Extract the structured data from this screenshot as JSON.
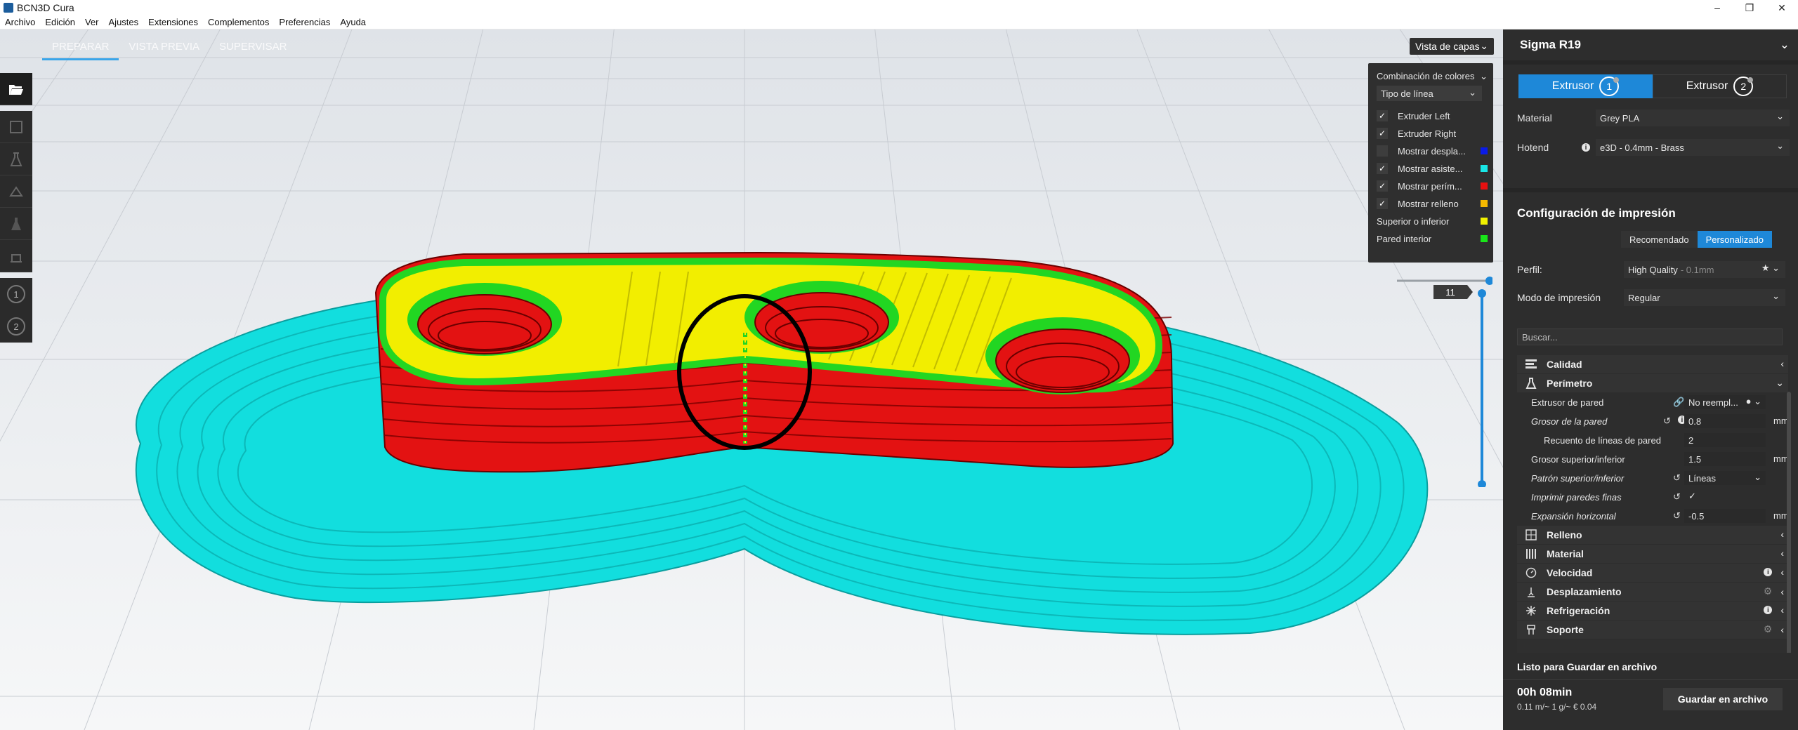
{
  "window": {
    "title": "BCN3D Cura",
    "minimize": "–",
    "maximize": "❐",
    "close": "✕"
  },
  "menu": [
    "Archivo",
    "Edición",
    "Ver",
    "Ajustes",
    "Extensiones",
    "Complementos",
    "Preferencias",
    "Ayuda"
  ],
  "stage_tabs": [
    "PREPARAR",
    "VISTA PREVIA",
    "SUPERVISAR"
  ],
  "view_select": {
    "label": "Vista de capas"
  },
  "color_panel": {
    "title": "Combinación de colores",
    "select": "Tipo de línea",
    "items": [
      {
        "label": "Extruder Left",
        "checked": true,
        "swatch": ""
      },
      {
        "label": "Extruder Right",
        "checked": true,
        "swatch": ""
      },
      {
        "label": "Mostrar despla...",
        "checked": false,
        "swatch": "#0a1be8"
      },
      {
        "label": "Mostrar asiste...",
        "checked": true,
        "swatch": "#19e6e6"
      },
      {
        "label": "Mostrar perím...",
        "checked": true,
        "swatch": "#e81010"
      },
      {
        "label": "Mostrar relleno",
        "checked": true,
        "swatch": "#f5b800"
      },
      {
        "label": "Superior o inferior",
        "checked": null,
        "swatch": "#f2f200"
      },
      {
        "label": "Pared interior",
        "checked": null,
        "swatch": "#19e619"
      }
    ]
  },
  "layer_slider": {
    "current_layer": "11"
  },
  "toolbar": {
    "open_icon": "folder-open-icon",
    "tools": [
      "move-icon",
      "scale-icon",
      "rotate-icon",
      "mirror-icon",
      "support-blocker-icon"
    ],
    "extruders": [
      "1",
      "2"
    ]
  },
  "side_panel": {
    "printer": "Sigma R19",
    "extruder_tabs": [
      {
        "label": "Extrusor",
        "num": "1",
        "active": true
      },
      {
        "label": "Extrusor",
        "num": "2",
        "active": false
      }
    ],
    "material_label": "Material",
    "material_value": "Grey PLA",
    "hotend_label": "Hotend",
    "hotend_value": "e3D - 0.4mm - Brass",
    "print_config_title": "Configuración de impresión",
    "mode_recommended": "Recomendado",
    "mode_custom": "Personalizado",
    "profile_label": "Perfil:",
    "profile_value": "High Quality",
    "profile_layer": "- 0.1mm",
    "print_mode_label": "Modo de impresión",
    "print_mode_value": "Regular",
    "search_placeholder": "Buscar...",
    "categories": {
      "calidad": "Calidad",
      "perimetro": "Perímetro",
      "relleno": "Relleno",
      "material": "Material",
      "velocidad": "Velocidad",
      "desplazamiento": "Desplazamiento",
      "refrigeracion": "Refrigeración",
      "soporte": "Soporte"
    },
    "settings": {
      "wall_extruder": {
        "label": "Extrusor de pared",
        "value": "No reempl..."
      },
      "wall_thickness": {
        "label": "Grosor de la pared",
        "value": "0.8",
        "unit": "mm"
      },
      "wall_line_count": {
        "label": "Recuento de líneas de pared",
        "value": "2"
      },
      "top_bottom_thickness": {
        "label": "Grosor superior/inferior",
        "value": "1.5",
        "unit": "mm"
      },
      "top_bottom_pattern": {
        "label": "Patrón superior/inferior",
        "value": "Líneas"
      },
      "thin_walls": {
        "label": "Imprimir paredes finas",
        "value": "✓"
      },
      "horizontal_expansion": {
        "label": "Expansión horizontal",
        "value": "-0.5",
        "unit": "mm"
      }
    },
    "status": "Listo para Guardar en archivo",
    "print_time": "00h 08min",
    "print_cost": "0.11 m/~ 1 g/~ € 0.04",
    "save_button": "Guardar en archivo"
  },
  "colors": {
    "accent": "#1e88d8",
    "skirt": "#19e6e6",
    "wall_outer": "#e81010",
    "wall_inner": "#19e619",
    "top_bottom": "#f2f200",
    "infill": "#f5b800"
  }
}
